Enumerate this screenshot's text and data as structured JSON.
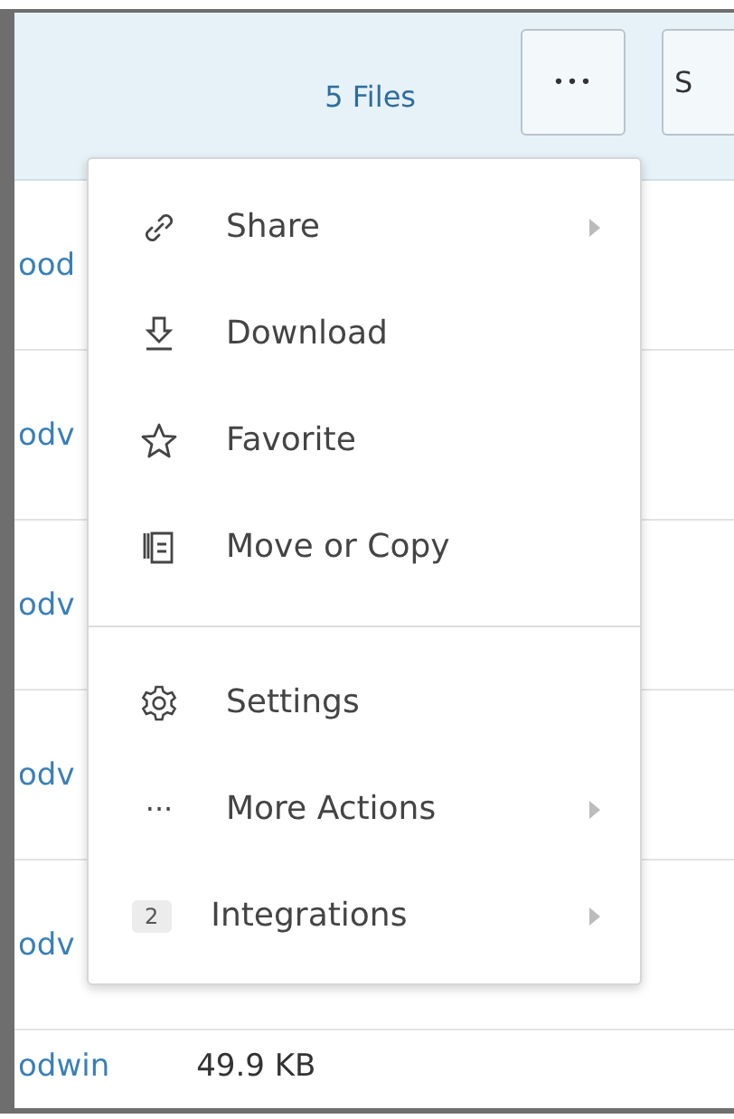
{
  "header": {
    "count": "5 Files",
    "more_button": "•••",
    "next_button": "S"
  },
  "rows": [
    {
      "name": "ood",
      "size": ""
    },
    {
      "name": "odv",
      "size": ""
    },
    {
      "name": "odv",
      "size": ""
    },
    {
      "name": "odv",
      "size": ""
    },
    {
      "name": "odv",
      "size": ""
    },
    {
      "name": "odwin",
      "size": "49.9 KB"
    }
  ],
  "menu": {
    "sections": [
      [
        {
          "kind": "share",
          "label": "Share",
          "submenu": true
        },
        {
          "kind": "download",
          "label": "Download",
          "submenu": false
        },
        {
          "kind": "star",
          "label": "Favorite",
          "submenu": false
        },
        {
          "kind": "copy",
          "label": "Move or Copy",
          "submenu": false
        }
      ],
      [
        {
          "kind": "gear",
          "label": "Settings",
          "submenu": false
        },
        {
          "kind": "dots",
          "label": "More Actions",
          "submenu": true,
          "glyph": "···"
        },
        {
          "kind": "badge",
          "label": "Integrations",
          "submenu": true,
          "badge": "2"
        }
      ]
    ]
  }
}
